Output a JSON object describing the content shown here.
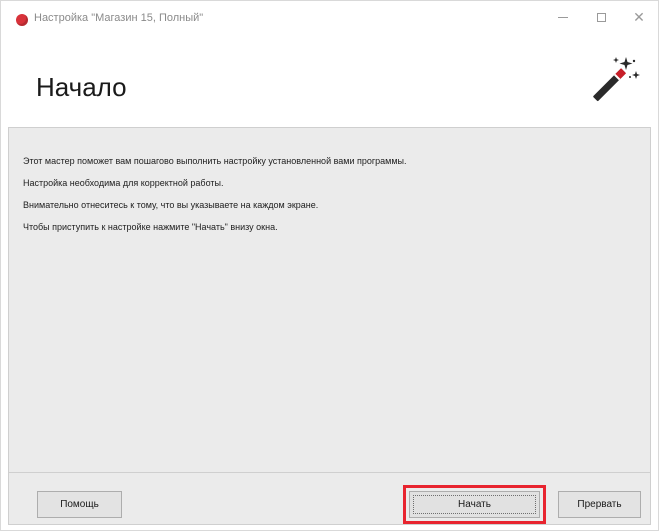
{
  "window": {
    "title": "Настройка \"Магазин 15, Полный\""
  },
  "header": {
    "title": "Начало",
    "icon": "magic-wand-icon"
  },
  "content": {
    "lines": [
      "Этот мастер поможет вам пошагово выполнить настройку установленной вами программы.",
      "Настройка необходима для корректной работы.",
      "Внимательно отнеситесь к тому, что вы указываете на каждом экране.",
      "Чтобы приступить к настройке нажмите \"Начать\" внизу окна."
    ]
  },
  "footer": {
    "help_label": "Помощь",
    "start_label": "Начать",
    "cancel_label": "Прервать"
  },
  "colors": {
    "highlight": "#e8242f",
    "panel_bg": "#ebebeb"
  }
}
